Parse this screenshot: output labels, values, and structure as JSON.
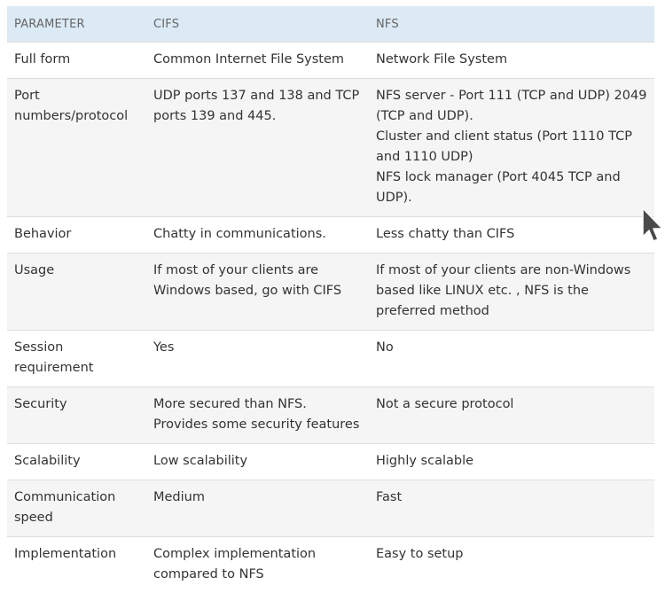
{
  "table": {
    "headers": [
      "PARAMETER",
      "CIFS",
      "NFS"
    ],
    "rows": [
      {
        "parameter": "Full form",
        "cifs": [
          "Common Internet File System"
        ],
        "nfs": [
          "Network File System"
        ]
      },
      {
        "parameter": "Port numbers/protocol",
        "cifs": [
          "UDP ports 137 and 138 and TCP ports 139 and 445."
        ],
        "nfs": [
          "NFS server - Port 111 (TCP and UDP) 2049 (TCP and UDP).",
          "Cluster and client status (Port 1110 TCP and 1110 UDP)",
          "NFS lock manager (Port 4045 TCP and UDP)."
        ]
      },
      {
        "parameter": "Behavior",
        "cifs": [
          "Chatty in communications."
        ],
        "nfs": [
          "Less chatty than CIFS"
        ]
      },
      {
        "parameter": "Usage",
        "cifs": [
          "If most of your clients are Windows based, go with CIFS"
        ],
        "nfs": [
          "If most of your clients are non-Windows based like LINUX etc. , NFS is the preferred method"
        ]
      },
      {
        "parameter": "Session requirement",
        "cifs": [
          "Yes"
        ],
        "nfs": [
          "No"
        ]
      },
      {
        "parameter": "Security",
        "cifs": [
          "More secured than NFS. Provides some security features"
        ],
        "nfs": [
          "Not a secure protocol"
        ]
      },
      {
        "parameter": "Scalability",
        "cifs": [
          "Low scalability"
        ],
        "nfs": [
          "Highly scalable"
        ]
      },
      {
        "parameter": "Communication speed",
        "cifs": [
          "Medium"
        ],
        "nfs": [
          "Fast"
        ]
      },
      {
        "parameter": "Implementation",
        "cifs": [
          "Complex implementation compared to NFS"
        ],
        "nfs": [
          "Easy to setup"
        ]
      }
    ]
  },
  "icons": {
    "cursor": "mouse-pointer-icon"
  },
  "colors": {
    "header_bg": "#dbeaf5",
    "row_alt_bg": "#f5f5f5",
    "text": "#333333",
    "header_text": "#666666"
  }
}
